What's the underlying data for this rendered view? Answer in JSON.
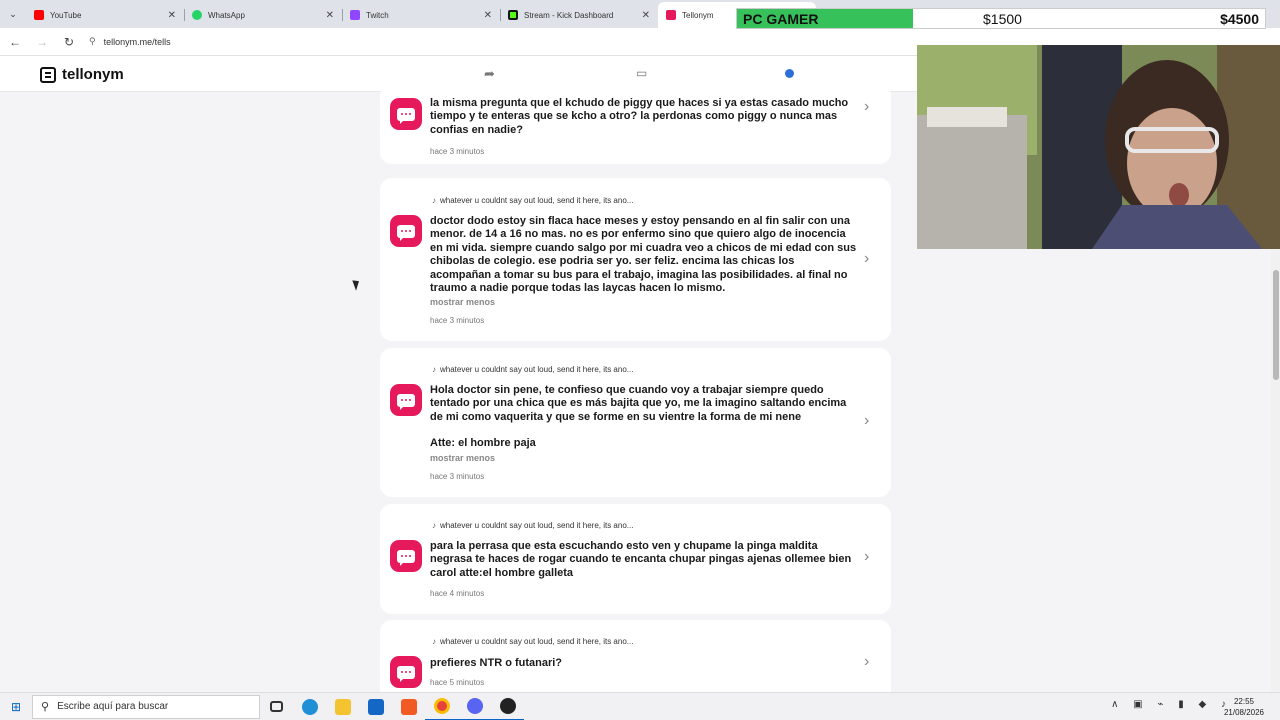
{
  "browser": {
    "tabs": [
      {
        "title": "YouTube",
        "color": "#ff0000",
        "active": false
      },
      {
        "title": "WhatsApp",
        "color": "#25d366",
        "active": false
      },
      {
        "title": "Twitch",
        "color": "#9146ff",
        "active": false
      },
      {
        "title": "Stream - Kick Dashboard",
        "color": "#53fc18",
        "active": false
      },
      {
        "title": "Tellonym",
        "color": "#e5195b",
        "active": true
      }
    ],
    "url": "tellonym.me/tells"
  },
  "app": {
    "name": "tellonym",
    "accent": "#e5195b"
  },
  "tells": [
    {
      "tag": "",
      "question": "la misma pregunta que el kchudo de piggy que haces si ya estas casado mucho tiempo y te enteras que se kcho a otro? la perdonas como piggy o nunca mas confias en nadie?",
      "more": "",
      "time": "hace 3 minutos"
    },
    {
      "tag": "whatever u couldnt say out loud, send it here, its ano...",
      "question": "doctor dodo estoy sin flaca hace meses y estoy pensando en al fin salir con una menor. de 14 a 16 no mas. no es por enfermo sino que quiero algo de inocencia en mi vida. siempre cuando salgo por mi cuadra veo a chicos de mi edad con sus chibolas de colegio. ese podria ser yo. ser feliz. encima las chicas los acompañan a tomar su bus para el trabajo, imagina las posibilidades. al final no traumo a nadie porque todas las laycas hacen lo mismo.",
      "more": "mostrar menos",
      "time": "hace 3 minutos"
    },
    {
      "tag": "whatever u couldnt say out loud, send it here, its ano...",
      "question": "Hola doctor sin pene, te confieso que cuando voy a trabajar siempre quedo tentado por una chica que es más bajita que yo, me la imagino saltando encima de mi como vaquerita y que se forme en su vientre la forma de mi nene",
      "signature": "Atte: el hombre paja",
      "more": "mostrar menos",
      "time": "hace 3 minutos"
    },
    {
      "tag": "whatever u couldnt say out loud, send it here, its ano...",
      "question": "para la perrasa que esta escuchando esto ven y chupame la pinga maldita negrasa te haces de rogar cuando te encanta chupar pingas ajenas ollemee bien carol atte:el hombre galleta",
      "more": "",
      "time": "hace 4 minutos"
    },
    {
      "tag": "whatever u couldnt say out loud, send it here, its ano...",
      "question": "prefieres NTR o futanari?",
      "more": "",
      "time": "hace 5 minutos"
    }
  ],
  "overlay": {
    "title": "PC GAMER",
    "current": "$1500",
    "goal": "$4500",
    "progress": 0.333,
    "color": "#37c15a"
  },
  "taskbar": {
    "search_placeholder": "Escribe aquí para buscar",
    "time": "22:55",
    "date": "21/08/2026"
  }
}
